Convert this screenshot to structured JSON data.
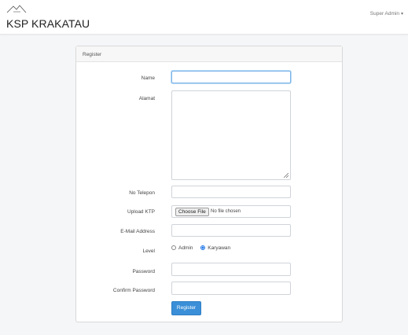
{
  "navbar": {
    "brand": "KSP KRAKATAU",
    "user_menu": "Super Admin"
  },
  "form": {
    "header": "Register",
    "fields": {
      "name": {
        "label": "Name",
        "value": ""
      },
      "alamat": {
        "label": "Alamat",
        "value": ""
      },
      "no_telepon": {
        "label": "No Telepon",
        "value": ""
      },
      "upload_ktp": {
        "label": "Upload KTP",
        "button": "Choose File",
        "status": "No file chosen"
      },
      "email": {
        "label": "E-Mail Address",
        "value": ""
      },
      "level": {
        "label": "Level",
        "options": [
          "Admin",
          "Karyawan"
        ],
        "selected": "Karyawan"
      },
      "password": {
        "label": "Password",
        "value": ""
      },
      "confirm_password": {
        "label": "Confirm Password",
        "value": ""
      }
    },
    "submit": "Register"
  },
  "colors": {
    "primary": "#3a8fd8",
    "focus_border": "#7ab3e8",
    "background": "#f5f6f8"
  }
}
